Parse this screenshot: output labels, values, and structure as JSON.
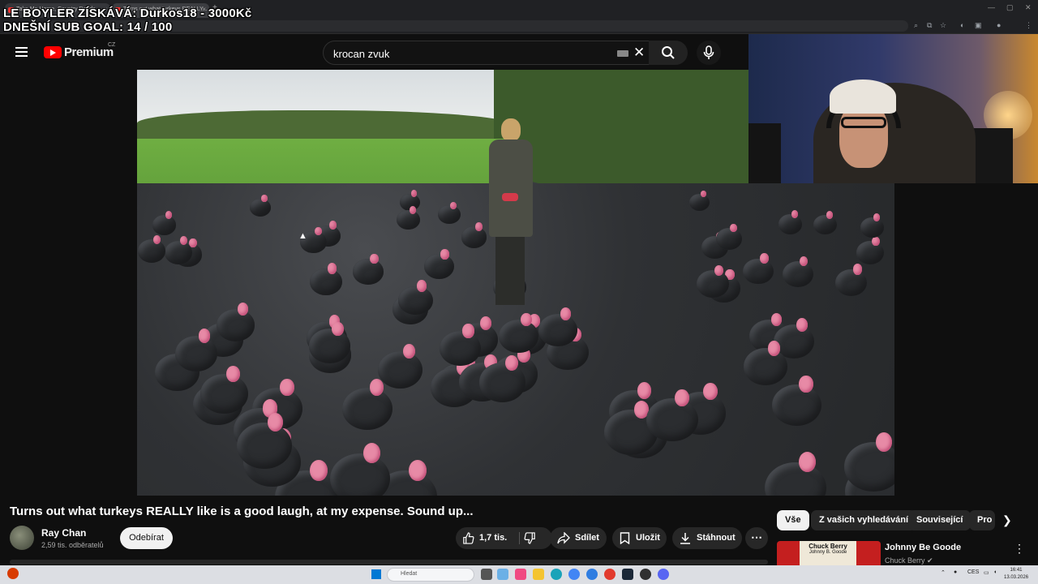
{
  "browser": {
    "tabs": [
      {
        "label": "Take Me Home, Country Roads"
      },
      {
        "label": "Turns out what turkeys REALLY..."
      }
    ],
    "new_tab": "+",
    "tab_close": "×"
  },
  "overlay": {
    "line1": "LE BOYLER ZÍSKÁVÁ: Durkos18 - 3000Kč",
    "line2": "DNEŠNÍ SUB GOAL: 14 / 100"
  },
  "header": {
    "logo_text": "Premium",
    "logo_region": "CZ",
    "search_value": "krocan zvuk"
  },
  "video": {
    "title": "Turns out what turkeys REALLY like is a good laugh, at my expense. Sound up...",
    "channel": "Ray Chan",
    "subscribers": "2,59 tis. odběratelů",
    "subscribe_label": "Odebírat",
    "likes": "1,7 tis.",
    "share_label": "Sdílet",
    "save_label": "Uložit",
    "download_label": "Stáhnout",
    "more": "⋯"
  },
  "chips": [
    {
      "label": "Vše",
      "active": true
    },
    {
      "label": "Z vašich vyhledávání",
      "active": false
    },
    {
      "label": "Související",
      "active": false
    },
    {
      "label": "Pro",
      "active": false
    }
  ],
  "recommendation": {
    "thumb_text": "Chuck Berry",
    "thumb_subtext": "Johnny B. Goode",
    "title": "Johnny Be Goode",
    "channel": "Chuck Berry"
  },
  "taskbar": {
    "search_placeholder": "Hledat",
    "lang": "CES",
    "time": "16:41",
    "date": "13.03.2026"
  },
  "colors": {
    "youtube_red": "#ff0000",
    "background": "#0f0f0f",
    "pill": "#272727"
  }
}
